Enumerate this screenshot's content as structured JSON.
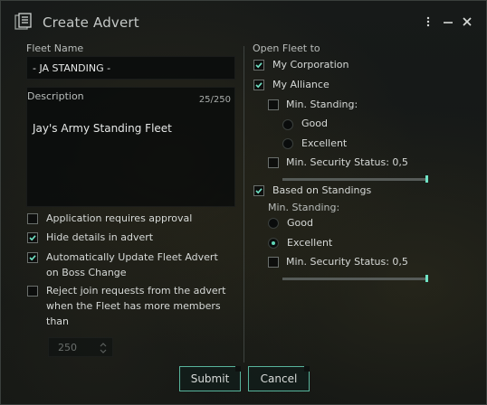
{
  "window": {
    "title": "Create Advert"
  },
  "titlebar": {
    "menu_icon": "kebab-menu-icon",
    "minimize_icon": "minimize-icon",
    "close_icon": "close-icon"
  },
  "left": {
    "fleet_name_label": "Fleet Name",
    "fleet_name_value": "- JA STANDING -",
    "description_label": "Description",
    "description_counter": "25/250",
    "description_value": "Jay's Army Standing Fleet",
    "options": [
      {
        "label": "Application requires approval",
        "checked": false
      },
      {
        "label": "Hide details in advert",
        "checked": true
      },
      {
        "label_line1": "Automatically Update Fleet Advert",
        "label_line2": "on Boss Change",
        "checked": true
      },
      {
        "label_line1": "Reject join requests from the advert",
        "label_line2": "when the Fleet has more members",
        "label_line3": "than",
        "checked": false
      }
    ],
    "max_members_value": "250"
  },
  "right": {
    "open_fleet_label": "Open Fleet to",
    "my_corporation": {
      "label": "My Corporation",
      "checked": true
    },
    "my_alliance": {
      "label": "My Alliance",
      "checked": true
    },
    "alliance_min_standing": {
      "label": "Min. Standing:",
      "checked": false
    },
    "alliance_good": {
      "label": "Good",
      "selected": false
    },
    "alliance_excellent": {
      "label": "Excellent",
      "selected": false
    },
    "alliance_min_security": {
      "label": "Min. Security Status: 0,5",
      "checked": false,
      "slider_level": 1.0
    },
    "based_on_standings": {
      "label": "Based on Standings",
      "checked": true
    },
    "standings_min_label": "Min. Standing:",
    "standings_good": {
      "label": "Good",
      "selected": false
    },
    "standings_excellent": {
      "label": "Excellent",
      "selected": true
    },
    "standings_min_security": {
      "label": "Min. Security Status: 0,5",
      "checked": false,
      "slider_level": 1.0
    }
  },
  "buttons": {
    "submit": "Submit",
    "cancel": "Cancel"
  },
  "colors": {
    "accent": "#5fd6b8",
    "border": "#58b49c",
    "background": "#121514"
  }
}
